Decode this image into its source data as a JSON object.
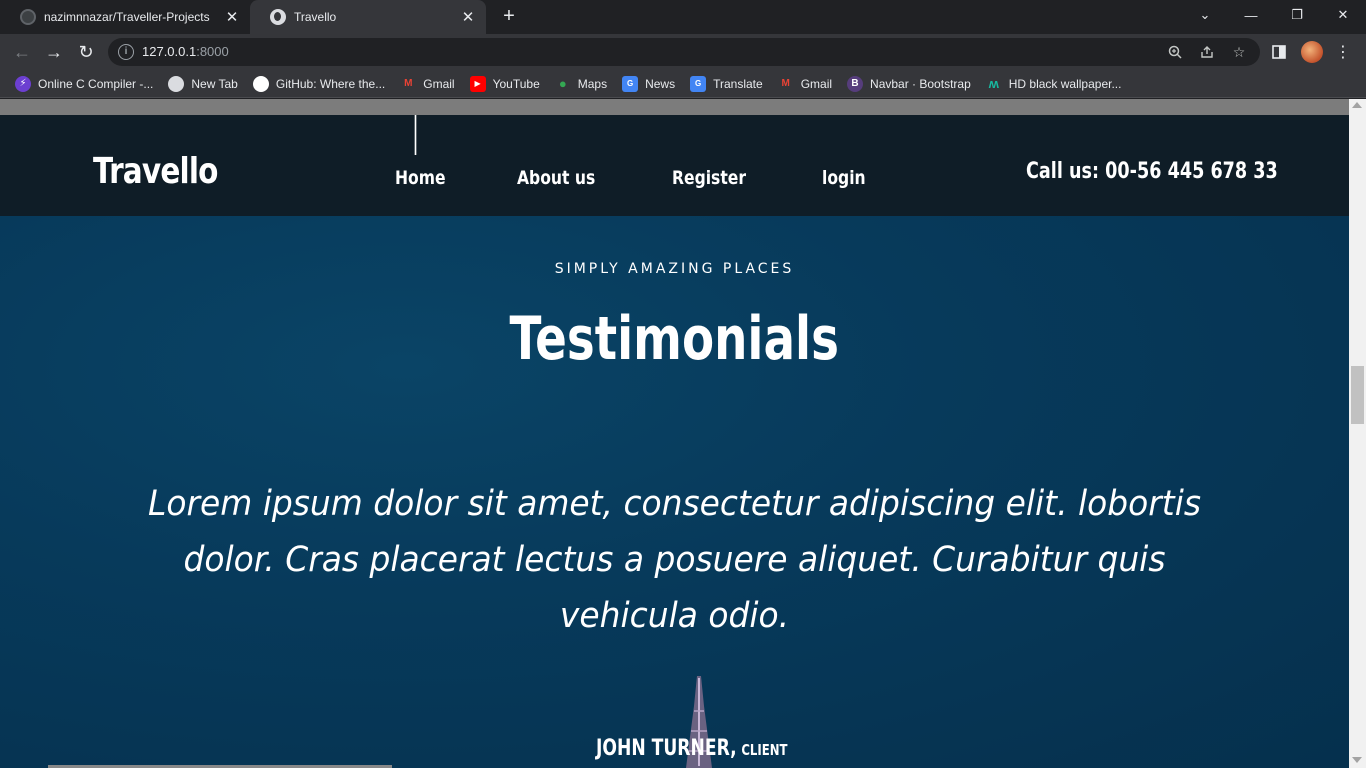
{
  "browser": {
    "tabs": [
      {
        "title": "nazimnnazar/Traveller-Projects",
        "active": false,
        "icon": "github-icon"
      },
      {
        "title": "Travello",
        "active": true,
        "icon": "globe-icon"
      }
    ],
    "new_tab_symbol": "+",
    "window_controls": {
      "tab_search": "⌄",
      "minimize": "—",
      "restore": "❐",
      "close": "✕"
    },
    "address": {
      "host": "127.0.0.1",
      "port": ":8000"
    },
    "bookmarks": [
      {
        "label": "Online C Compiler -...",
        "icon": "compiler-icon",
        "color": "#6c3fd1"
      },
      {
        "label": "New Tab",
        "icon": "globe-icon",
        "color": "#dadce0"
      },
      {
        "label": "GitHub: Where the...",
        "icon": "github-icon",
        "color": "#ffffff"
      },
      {
        "label": "Gmail",
        "icon": "gmail-icon",
        "color": "#ea4335"
      },
      {
        "label": "YouTube",
        "icon": "youtube-icon",
        "color": "#ff0000"
      },
      {
        "label": "Maps",
        "icon": "maps-icon",
        "color": "#34a853"
      },
      {
        "label": "News",
        "icon": "news-icon",
        "color": "#4285f4"
      },
      {
        "label": "Translate",
        "icon": "translate-icon",
        "color": "#4285f4"
      },
      {
        "label": "Gmail",
        "icon": "gmail-icon",
        "color": "#ea4335"
      },
      {
        "label": "Navbar · Bootstrap",
        "icon": "bootstrap-icon",
        "color": "#563d7c"
      },
      {
        "label": "HD black wallpaper...",
        "icon": "wallpaper-icon",
        "color": "#18b9a0"
      }
    ]
  },
  "site": {
    "logo": "Travello",
    "menu": [
      "Home",
      "About us",
      "Register",
      "login"
    ],
    "call": "Call us: 00-56 445 678 33"
  },
  "testimonial": {
    "kicker": "SIMPLY AMAZING PLACES",
    "heading": "Testimonials",
    "quote": "Lorem ipsum dolor sit amet, consectetur adipiscing elit. lobortis dolor. Cras placerat lectus a posuere aliquet. Curabitur quis vehicula odio.",
    "author_name": "JOHN TURNER,",
    "author_role": "CLIENT"
  },
  "colors": {
    "header_bg": "#0f1d27",
    "section_bg": "#073a5b",
    "chrome_dark": "#202124",
    "chrome_toolbar": "#35363a"
  }
}
